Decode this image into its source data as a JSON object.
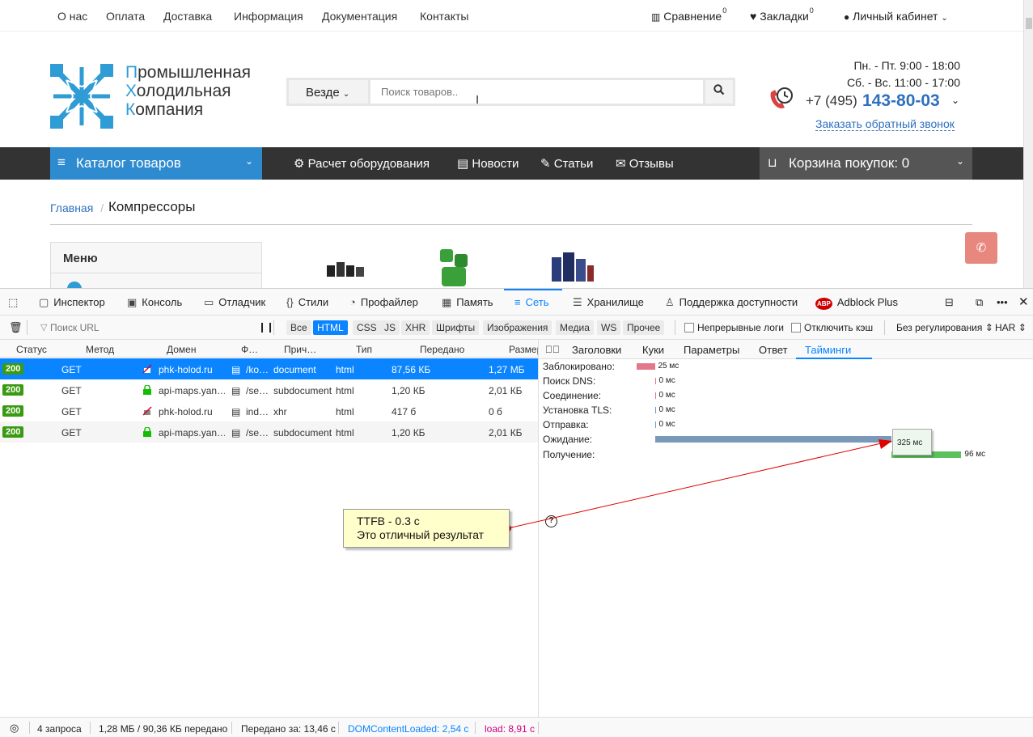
{
  "site": {
    "topnav": [
      "О нас",
      "Оплата",
      "Доставка",
      "Информация",
      "Документация",
      "Контакты"
    ],
    "compare": {
      "label": "Сравнение",
      "count": "0"
    },
    "bookmarks": {
      "label": "Закладки",
      "count": "0"
    },
    "account": "Личный кабинет",
    "logo_lines": [
      {
        "first": "П",
        "rest": "ромышленная"
      },
      {
        "first": "Х",
        "rest": "олодильная"
      },
      {
        "first": "К",
        "rest": "омпания"
      }
    ],
    "search": {
      "scope": "Везде",
      "placeholder": "Поиск товаров.."
    },
    "hours": [
      "Пн. - Пт. 9:00 - 18:00",
      "Сб. - Вс. 11:00 - 17:00"
    ],
    "phone_prefix": "+7 (495)",
    "phone_number": "143-80-03",
    "callback": "Заказать обратный звонок",
    "catalog": "Каталог товаров",
    "nav": [
      "Расчет оборудования",
      "Новости",
      "Статьи",
      "Отзывы"
    ],
    "cart": "Корзина покупок: 0",
    "breadcrumb_home": "Главная",
    "page_title": "Компрессоры",
    "menu_title": "Меню"
  },
  "devtools": {
    "tabs": [
      "Инспектор",
      "Консоль",
      "Отладчик",
      "Стили",
      "Профайлер",
      "Память",
      "Сеть",
      "Хранилище",
      "Поддержка доступности",
      "Adblock Plus"
    ],
    "filter_placeholder": "Поиск URL",
    "types": [
      "Все",
      "HTML",
      "CSS",
      "JS",
      "XHR",
      "Шрифты",
      "Изображения",
      "Медиа",
      "WS",
      "Прочее"
    ],
    "persist_logs": "Непрерывные логи",
    "disable_cache": "Отключить кэш",
    "throttling": "Без регулирования",
    "har": "HAR",
    "columns": [
      "Статус",
      "Метод",
      "Домен",
      "Ф…",
      "Прич…",
      "Тип",
      "Передано",
      "Размер"
    ],
    "rows": [
      {
        "status": "200",
        "method": "GET",
        "domain": "phk-holod.ru",
        "secure": false,
        "file": "/ko…",
        "cause": "document",
        "type": "html",
        "transferred": "87,56 КБ",
        "size": "1,27 МБ"
      },
      {
        "status": "200",
        "method": "GET",
        "domain": "api-maps.yan…",
        "secure": true,
        "file": "/se…",
        "cause": "subdocument",
        "type": "html",
        "transferred": "1,20 КБ",
        "size": "2,01 КБ"
      },
      {
        "status": "200",
        "method": "GET",
        "domain": "phk-holod.ru",
        "secure": false,
        "file": "ind…",
        "cause": "xhr",
        "type": "html",
        "transferred": "417 б",
        "size": "0 б"
      },
      {
        "status": "200",
        "method": "GET",
        "domain": "api-maps.yan…",
        "secure": true,
        "file": "/se…",
        "cause": "subdocument",
        "type": "html",
        "transferred": "1,20 КБ",
        "size": "2,01 КБ"
      }
    ],
    "detail_tabs": [
      "Заголовки",
      "Куки",
      "Параметры",
      "Ответ",
      "Тайминги"
    ],
    "timings": [
      {
        "label": "Заблокировано:",
        "value": "25 мс",
        "ms": 25,
        "start": 0,
        "color": "#e3788a"
      },
      {
        "label": "Поиск DNS:",
        "value": "0 мс",
        "ms": 0,
        "start": 25,
        "color": "#e3788a"
      },
      {
        "label": "Соединение:",
        "value": "0 мс",
        "ms": 0,
        "start": 25,
        "color": "#e3788a"
      },
      {
        "label": "Установка TLS:",
        "value": "0 мс",
        "ms": 0,
        "start": 25,
        "color": "#6a9ad3"
      },
      {
        "label": "Отправка:",
        "value": "0 мс",
        "ms": 0,
        "start": 25,
        "color": "#6a9ad3"
      },
      {
        "label": "Ожидание:",
        "value": "325 мс",
        "ms": 325,
        "start": 25,
        "color": "#7a98b8"
      },
      {
        "label": "Получение:",
        "value": "96 мс",
        "ms": 96,
        "start": 350,
        "color": "#5cc05c"
      }
    ],
    "status": {
      "requests": "4 запроса",
      "transferred": "1,28 МБ / 90,36 КБ передано",
      "finish": "Передано за: 13,46 с",
      "dom": "DOMContentLoaded: 2,54 с",
      "load": "load: 8,91 с"
    }
  },
  "annotation": [
    "TTFB - 0.3 с",
    "Это отличный результат"
  ],
  "tooltip": "325 мс",
  "colors": {
    "accent": "#2f8bd0",
    "phone": "#2f6fbd",
    "status_ok": "#3a9a12",
    "selection": "#0a84ff",
    "note_bg": "#ffffcc",
    "arrow": "#e00000"
  }
}
